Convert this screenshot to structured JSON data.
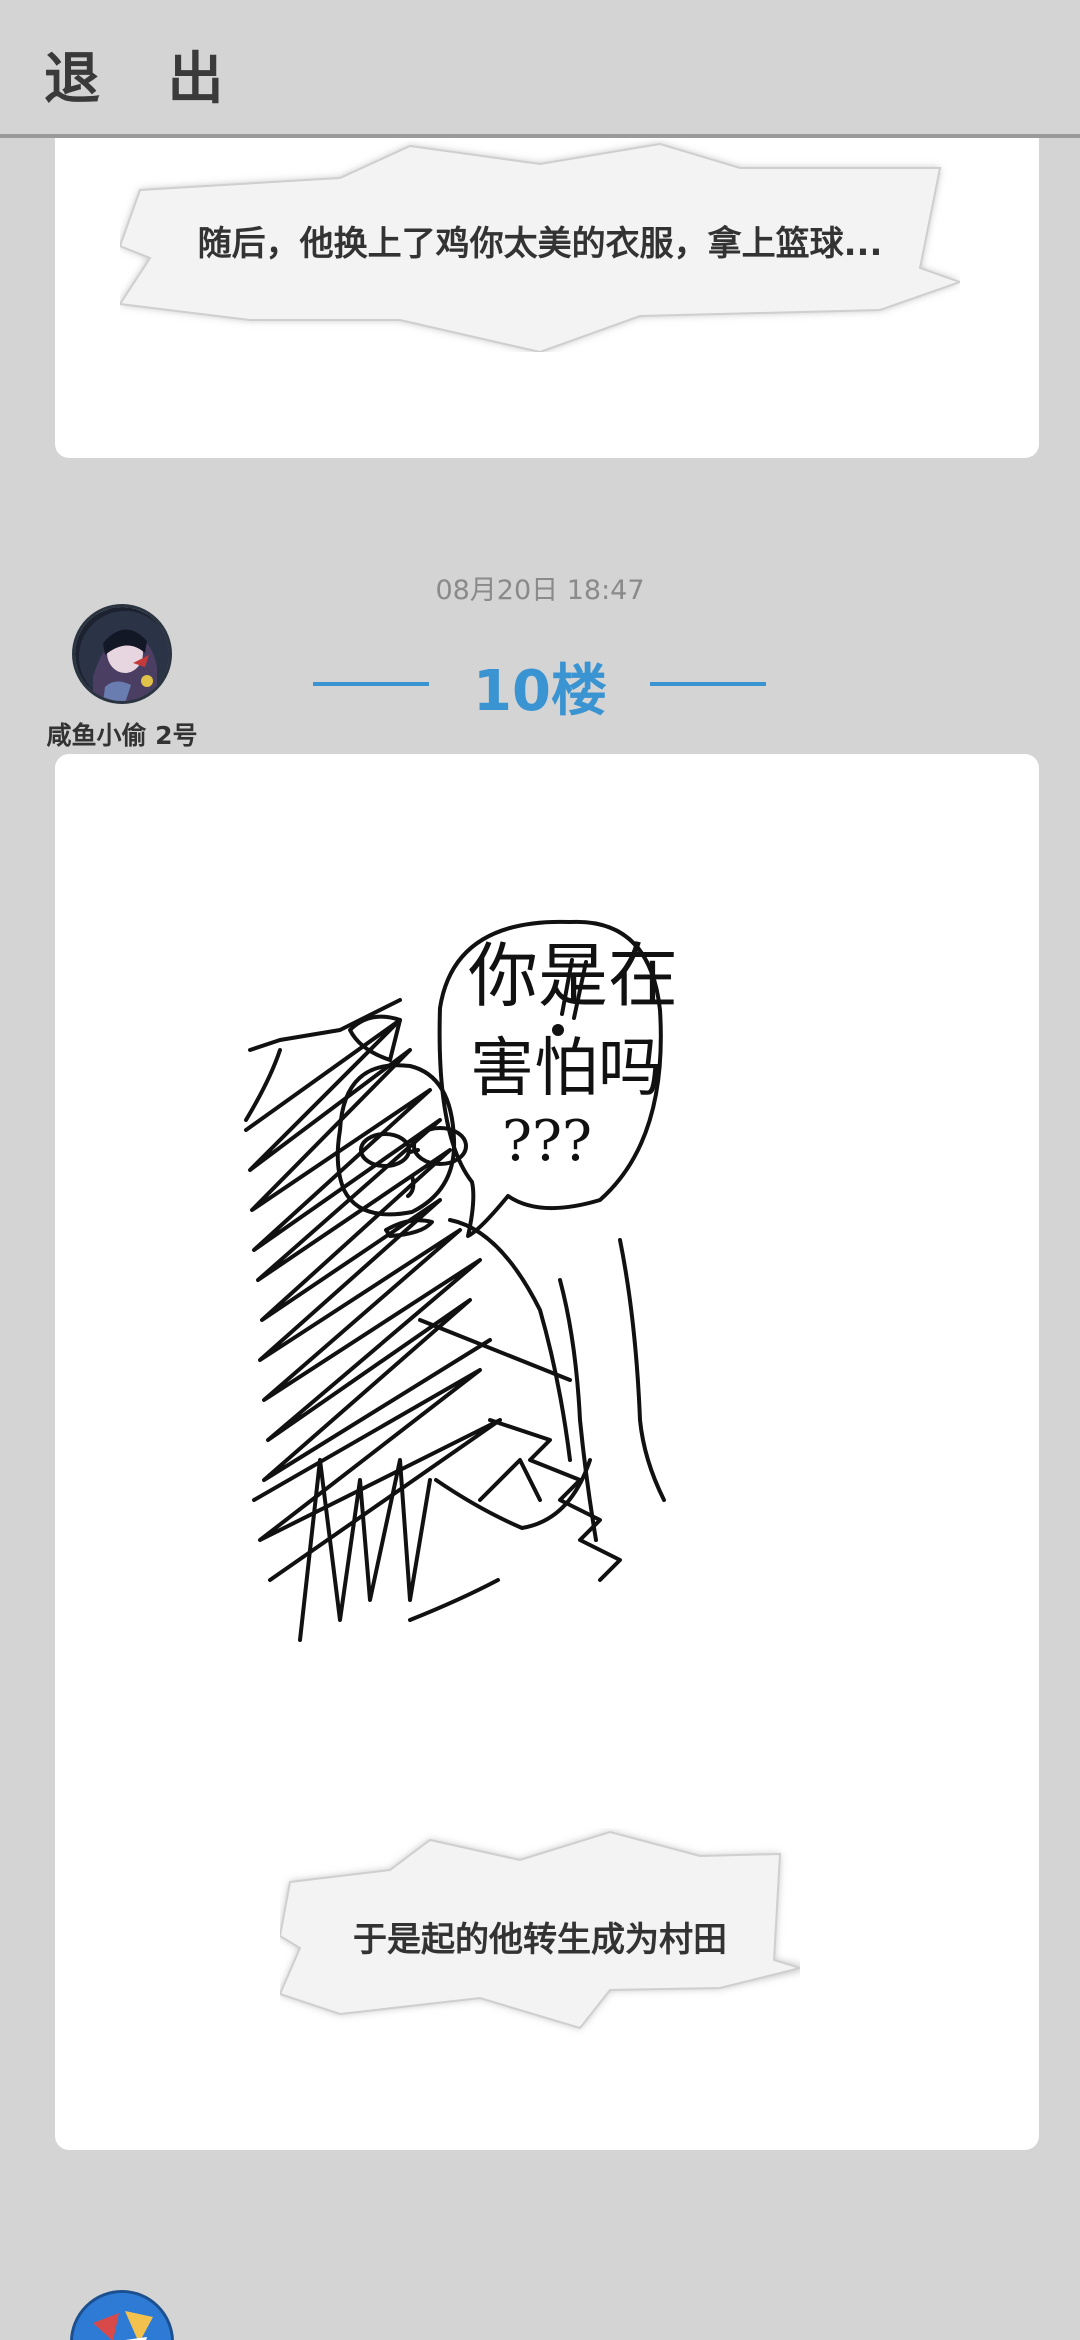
{
  "header": {
    "exit_label": "退 出"
  },
  "previous_post": {
    "caption": "随后，他换上了鸡你太美的衣服，拿上篮球..."
  },
  "post": {
    "timestamp": "08月20日  18:47",
    "floor_label": "10楼",
    "username": "咸鱼小偷 2号",
    "drawing_text": [
      "你是在",
      "害怕吗",
      "???"
    ],
    "drawing_exclaim": "!",
    "caption": "于是起的他转生成为村田"
  },
  "colors": {
    "background": "#d4d4d4",
    "card": "#ffffff",
    "accent": "#3a94d2",
    "text": "#333333",
    "muted": "#8a8a8a"
  }
}
